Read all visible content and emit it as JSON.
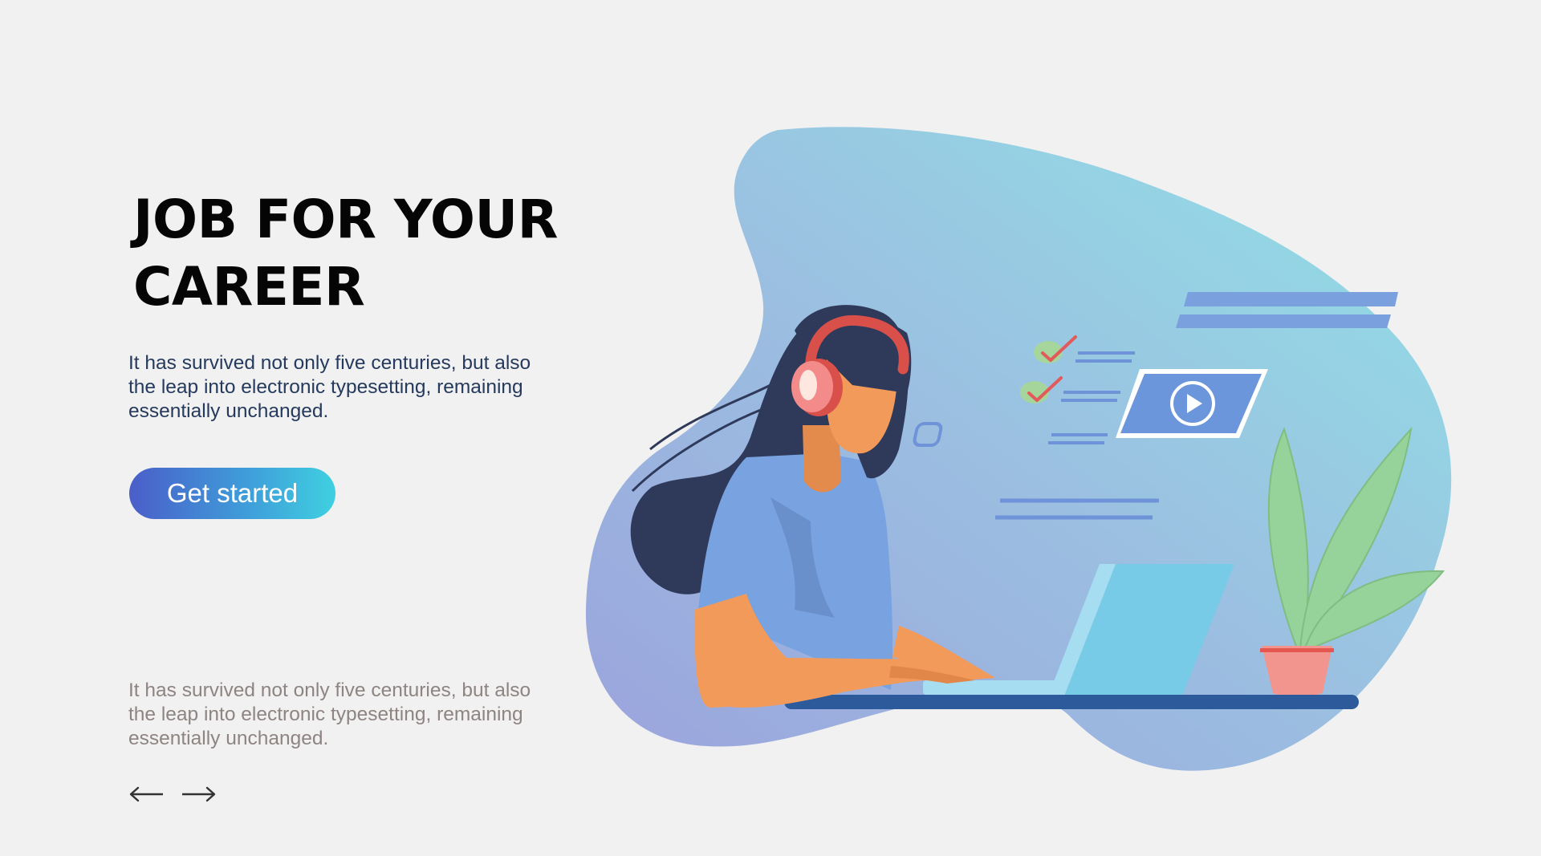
{
  "hero": {
    "title": "JOB FOR YOUR CAREER",
    "description": "It has survived not only five centuries, but also the leap into electronic typesetting, remaining essentially unchanged.",
    "cta_label": "Get started"
  },
  "secondary": {
    "description": "It has survived not only five centuries, but also the leap into electronic typesetting, remaining essentially unchanged."
  },
  "navigation": {
    "prev_icon": "arrow-left-icon",
    "next_icon": "arrow-right-icon"
  },
  "colors": {
    "background": "#f1f1f1",
    "cta_gradient_start": "#4a5ec9",
    "cta_gradient_end": "#3fd0e1",
    "title": "#050505",
    "description": "#253a5e",
    "secondary_description": "#8e8482"
  }
}
